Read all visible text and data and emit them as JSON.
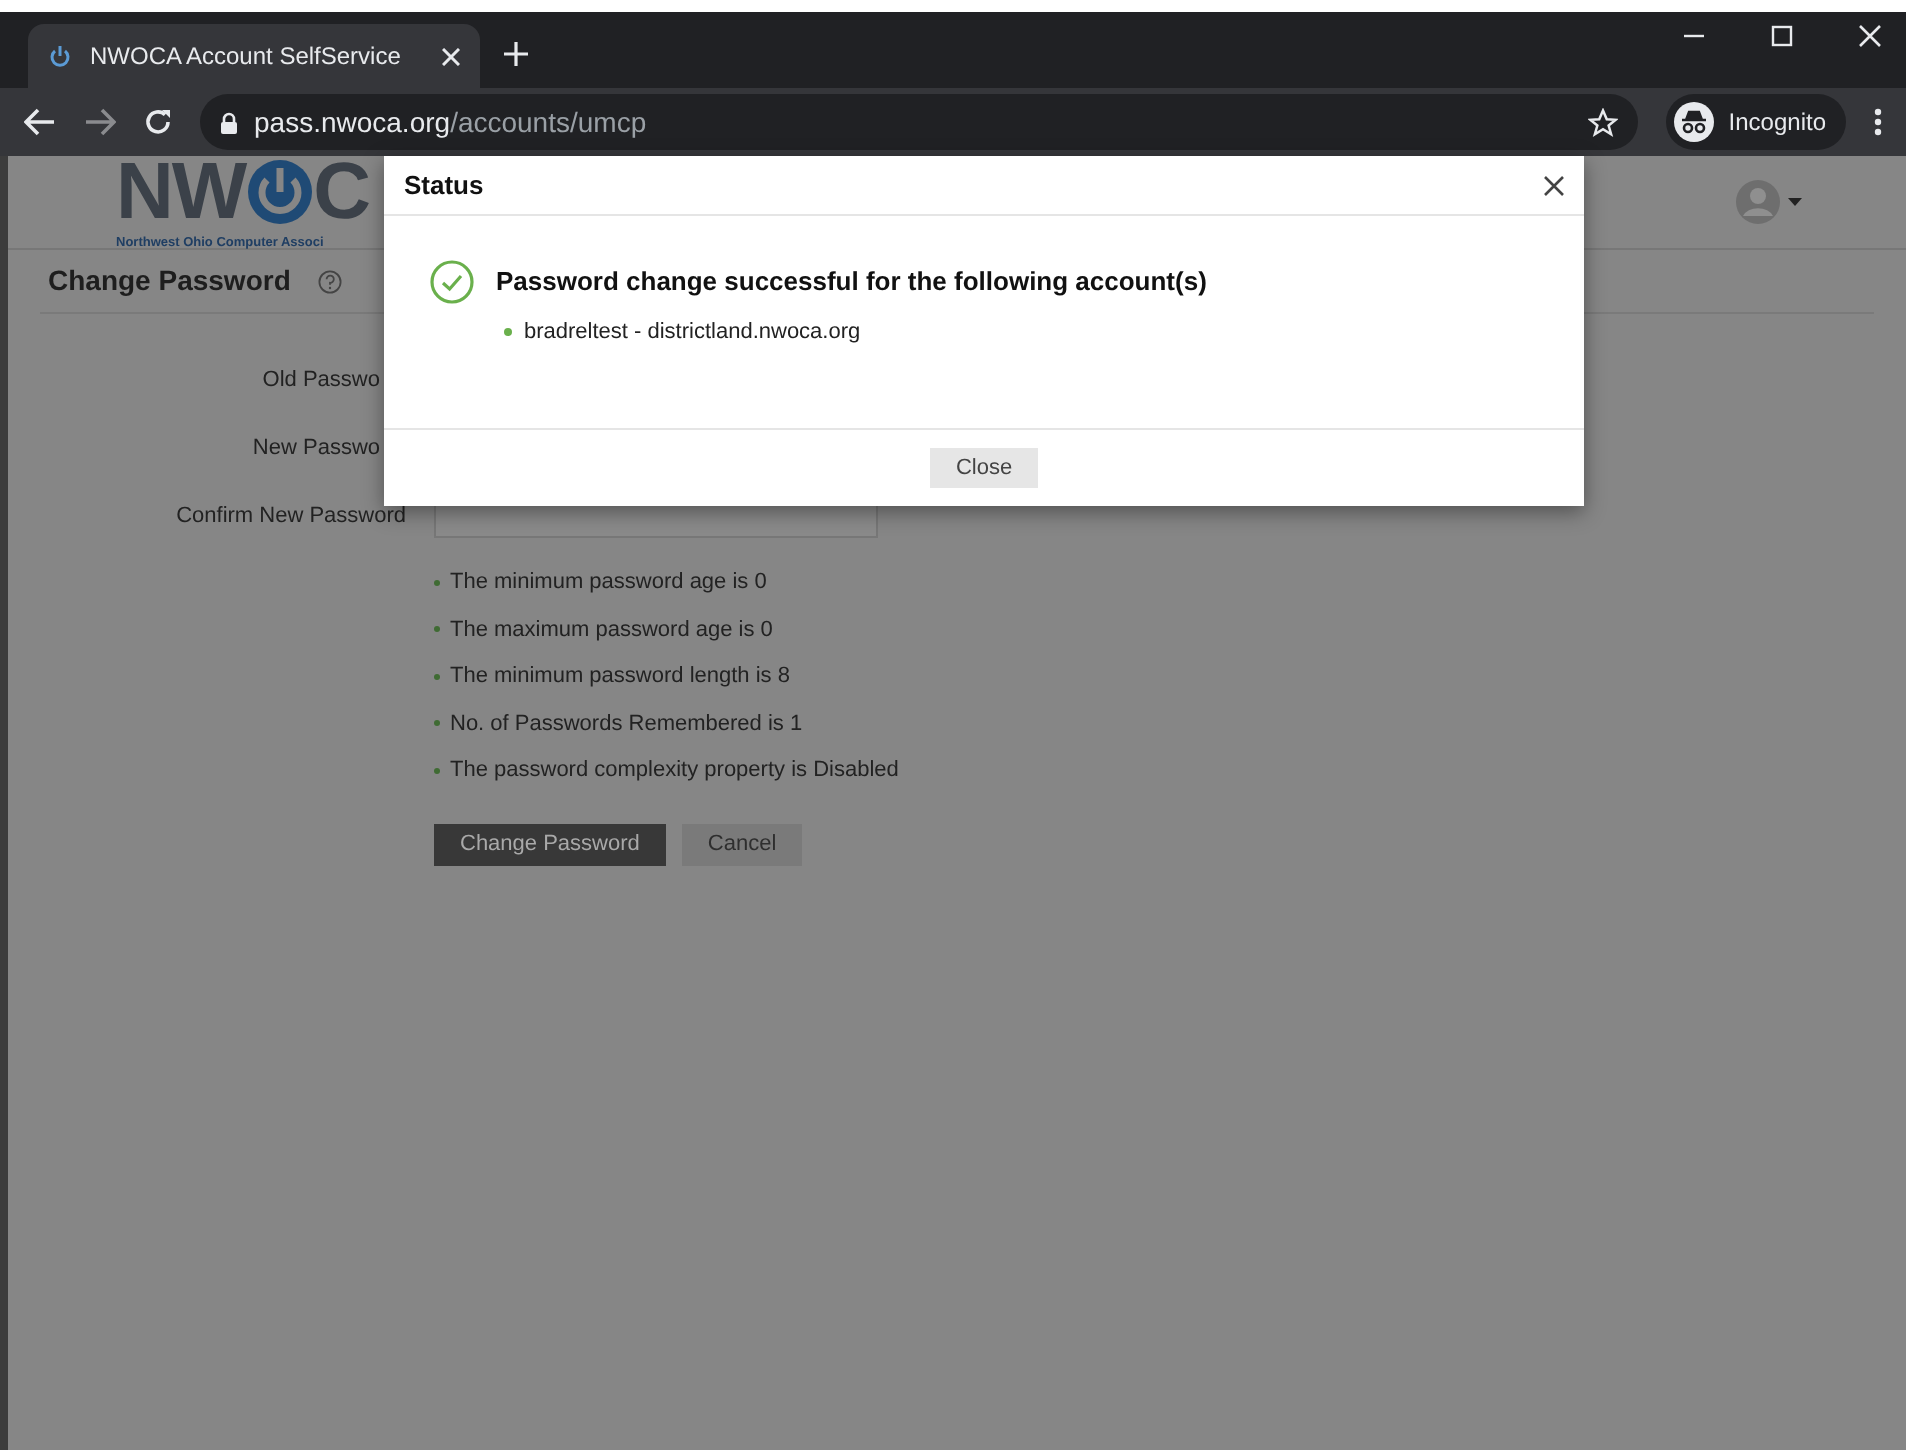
{
  "browser": {
    "tabs": [
      {
        "title": "NWOCA Account SelfService",
        "selected": true
      }
    ],
    "address": {
      "host": "pass.nwoca.org",
      "path": "/accounts/umcp"
    },
    "profile": "Incognito"
  },
  "header": {
    "logo_left": "NW",
    "logo_right": "C",
    "logo_subtitle": "Northwest Ohio Computer Associ"
  },
  "page": {
    "title": "Change Password",
    "fields": [
      {
        "label": "Old Passwo"
      },
      {
        "label": "New Passwo"
      },
      {
        "label": "Confirm New Password"
      }
    ],
    "rules": [
      "The minimum password age is 0",
      "The maximum password age is 0",
      "The minimum password length is 8",
      "No. of Passwords Remembered is 1",
      "The password complexity property is Disabled"
    ],
    "buttons": [
      {
        "label": "Change Password",
        "kind": "primary"
      },
      {
        "label": "Cancel",
        "kind": "secondary"
      }
    ]
  },
  "dialog": {
    "title": "Status",
    "message": "Password change successful for the following account(s)",
    "accounts": [
      "bradreltest - districtland.nwoca.org"
    ],
    "button": "Close"
  }
}
